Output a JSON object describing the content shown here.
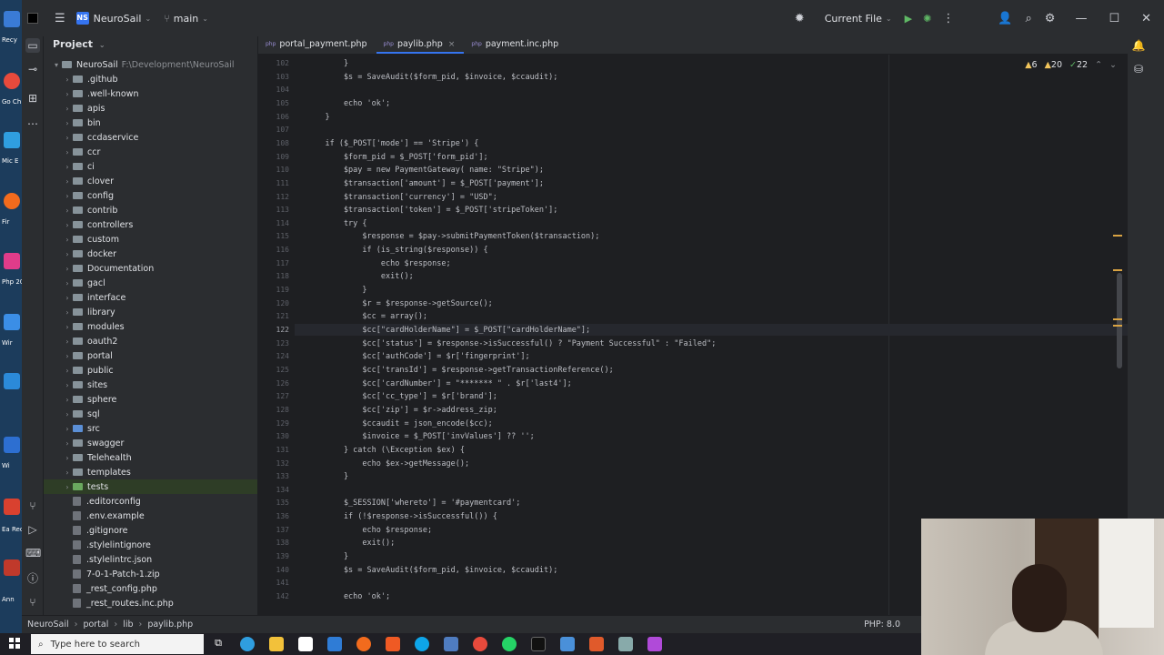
{
  "titlebar": {
    "project_badge": "NS",
    "project_name": "NeuroSail",
    "branch": "main",
    "run_config": "Current File"
  },
  "desktop_labels": [
    "Recy",
    "Go Ch",
    "Mic E",
    "Fir",
    "Php 20",
    "Wir",
    "Wi",
    "Ea Rec",
    "Ann"
  ],
  "project_panel": {
    "title": "Project",
    "root_name": "NeuroSail",
    "root_path": "F:\\Development\\NeuroSail",
    "items": [
      {
        "label": ".github",
        "type": "folder"
      },
      {
        "label": ".well-known",
        "type": "folder"
      },
      {
        "label": "apis",
        "type": "folder"
      },
      {
        "label": "bin",
        "type": "folder"
      },
      {
        "label": "ccdaservice",
        "type": "folder"
      },
      {
        "label": "ccr",
        "type": "folder"
      },
      {
        "label": "ci",
        "type": "folder"
      },
      {
        "label": "clover",
        "type": "folder"
      },
      {
        "label": "config",
        "type": "folder"
      },
      {
        "label": "contrib",
        "type": "folder"
      },
      {
        "label": "controllers",
        "type": "folder"
      },
      {
        "label": "custom",
        "type": "folder"
      },
      {
        "label": "docker",
        "type": "folder"
      },
      {
        "label": "Documentation",
        "type": "folder"
      },
      {
        "label": "gacl",
        "type": "folder"
      },
      {
        "label": "interface",
        "type": "folder"
      },
      {
        "label": "library",
        "type": "folder"
      },
      {
        "label": "modules",
        "type": "folder"
      },
      {
        "label": "oauth2",
        "type": "folder"
      },
      {
        "label": "portal",
        "type": "folder"
      },
      {
        "label": "public",
        "type": "folder"
      },
      {
        "label": "sites",
        "type": "folder"
      },
      {
        "label": "sphere",
        "type": "folder"
      },
      {
        "label": "sql",
        "type": "folder"
      },
      {
        "label": "src",
        "type": "folder"
      },
      {
        "label": "swagger",
        "type": "folder"
      },
      {
        "label": "Telehealth",
        "type": "folder"
      },
      {
        "label": "templates",
        "type": "folder"
      },
      {
        "label": "tests",
        "type": "folder"
      },
      {
        "label": ".editorconfig",
        "type": "file"
      },
      {
        "label": ".env.example",
        "type": "file"
      },
      {
        "label": ".gitignore",
        "type": "file"
      },
      {
        "label": ".stylelintignore",
        "type": "file"
      },
      {
        "label": ".stylelintrc.json",
        "type": "file"
      },
      {
        "label": "7-0-1-Patch-1.zip",
        "type": "file"
      },
      {
        "label": "_rest_config.php",
        "type": "file"
      },
      {
        "label": "_rest_routes.inc.php",
        "type": "file"
      }
    ]
  },
  "tabs": [
    {
      "label": "portal_payment.php",
      "active": false
    },
    {
      "label": "paylib.php",
      "active": true
    },
    {
      "label": "payment.inc.php",
      "active": false
    }
  ],
  "inspections": {
    "warnings": "6",
    "weak_warnings": "20",
    "typos": "22"
  },
  "code": {
    "current_line": "122",
    "lines": [
      {
        "n": "102",
        "t": "        }"
      },
      {
        "n": "103",
        "t": "        $s = SaveAudit($form_pid, $invoice, $ccaudit);"
      },
      {
        "n": "104",
        "t": ""
      },
      {
        "n": "105",
        "t": "        echo 'ok';"
      },
      {
        "n": "106",
        "t": "    }"
      },
      {
        "n": "107",
        "t": ""
      },
      {
        "n": "108",
        "t": "    if ($_POST['mode'] == 'Stripe') {"
      },
      {
        "n": "109",
        "t": "        $form_pid = $_POST['form_pid'];"
      },
      {
        "n": "110",
        "t": "        $pay = new PaymentGateway( name: \"Stripe\");"
      },
      {
        "n": "111",
        "t": "        $transaction['amount'] = $_POST['payment'];"
      },
      {
        "n": "112",
        "t": "        $transaction['currency'] = \"USD\";"
      },
      {
        "n": "113",
        "t": "        $transaction['token'] = $_POST['stripeToken'];"
      },
      {
        "n": "114",
        "t": "        try {"
      },
      {
        "n": "115",
        "t": "            $response = $pay->submitPaymentToken($transaction);"
      },
      {
        "n": "116",
        "t": "            if (is_string($response)) {"
      },
      {
        "n": "117",
        "t": "                echo $response;"
      },
      {
        "n": "118",
        "t": "                exit();"
      },
      {
        "n": "119",
        "t": "            }"
      },
      {
        "n": "120",
        "t": "            $r = $response->getSource();"
      },
      {
        "n": "121",
        "t": "            $cc = array();"
      },
      {
        "n": "122",
        "t": "            $cc[\"cardHolderName\"] = $_POST[\"cardHolderName\"];"
      },
      {
        "n": "123",
        "t": "            $cc['status'] = $response->isSuccessful() ? \"Payment Successful\" : \"Failed\";"
      },
      {
        "n": "124",
        "t": "            $cc['authCode'] = $r['fingerprint'];"
      },
      {
        "n": "125",
        "t": "            $cc['transId'] = $response->getTransactionReference();"
      },
      {
        "n": "126",
        "t": "            $cc['cardNumber'] = \"******* \" . $r['last4'];"
      },
      {
        "n": "127",
        "t": "            $cc['cc_type'] = $r['brand'];"
      },
      {
        "n": "128",
        "t": "            $cc['zip'] = $r->address_zip;"
      },
      {
        "n": "129",
        "t": "            $ccaudit = json_encode($cc);"
      },
      {
        "n": "130",
        "t": "            $invoice = $_POST['invValues'] ?? '';"
      },
      {
        "n": "131",
        "t": "        } catch (\\Exception $ex) {"
      },
      {
        "n": "132",
        "t": "            echo $ex->getMessage();"
      },
      {
        "n": "133",
        "t": "        }"
      },
      {
        "n": "134",
        "t": ""
      },
      {
        "n": "135",
        "t": "        $_SESSION['whereto'] = '#paymentcard';"
      },
      {
        "n": "136",
        "t": "        if (!$response->isSuccessful()) {"
      },
      {
        "n": "137",
        "t": "            echo $response;"
      },
      {
        "n": "138",
        "t": "            exit();"
      },
      {
        "n": "139",
        "t": "        }"
      },
      {
        "n": "140",
        "t": "        $s = SaveAudit($form_pid, $invoice, $ccaudit);"
      },
      {
        "n": "141",
        "t": ""
      },
      {
        "n": "142",
        "t": "        echo 'ok';"
      }
    ]
  },
  "statusbar": {
    "crumbs": [
      "NeuroSail",
      "portal",
      "lib",
      "paylib.php"
    ],
    "language": "PHP: 8.0"
  },
  "taskbar": {
    "search_placeholder": "Type here to search"
  },
  "colors": {
    "accent": "#3574f0",
    "warning": "#f2c55c",
    "editor_bg": "#1e1f22",
    "panel_bg": "#2b2d30"
  }
}
